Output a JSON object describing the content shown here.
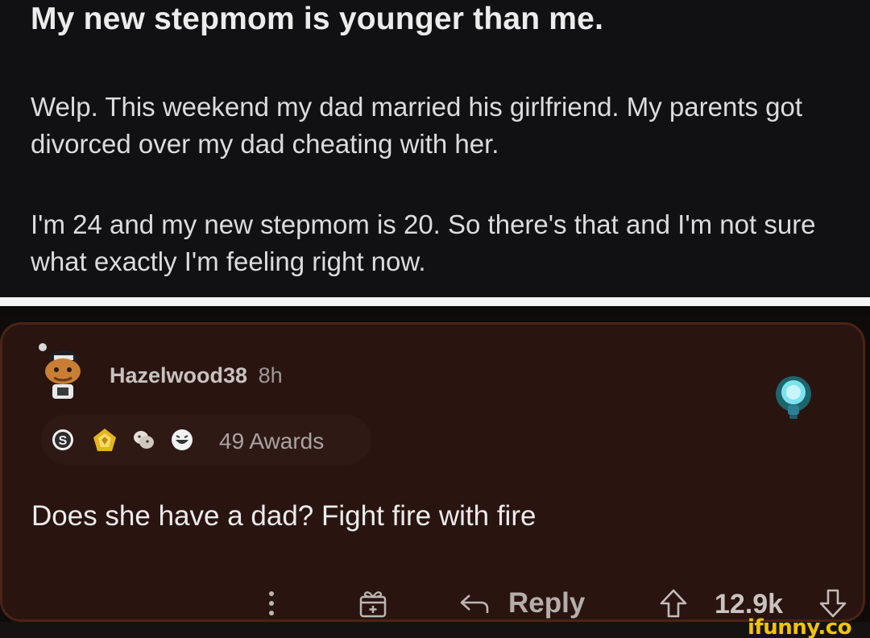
{
  "post": {
    "title": "My new stepmom is younger than me.",
    "paragraphs": [
      "Welp. This weekend my dad married his girlfriend. My parents got divorced over my dad cheating with her.",
      "I'm 24 and my new stepmom is 20. So there's that and I'm not sure what exactly I'm feeling right now."
    ]
  },
  "comment": {
    "username": "Hazelwood38",
    "timestamp": "8h",
    "awards_label": "49 Awards",
    "award_icons": [
      "silver-award-icon",
      "gold-award-icon",
      "hugs-award-icon",
      "laughing-award-icon"
    ],
    "body": "Does she have a dad? Fight fire with fire",
    "actions": {
      "reply_label": "Reply",
      "score": "12.9k"
    }
  },
  "colors": {
    "post_background": "#111113",
    "comment_background": "#2a1410",
    "comment_border": "#4a2414",
    "watermark": "#f2c400"
  },
  "watermark": "ifunny.co"
}
